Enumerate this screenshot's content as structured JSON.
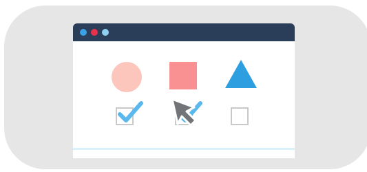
{
  "colors": {
    "page_background": "#ffffff",
    "backdrop": "#e6e6e6",
    "titlebar": "#2a3e5a",
    "window_controls": [
      "#3ca0e6",
      "#e8314b",
      "#8fd0f2"
    ],
    "circle": "#fcc6bd",
    "square": "#f99193",
    "triangle": "#2d9ee0",
    "checkbox_border": "#c9c9c9",
    "checkmark": "#5bb8ec",
    "cursor_fill": "#727478",
    "cursor_outline": "#ffffff",
    "footer_line": "#d9f1fb"
  },
  "window": {
    "controls": [
      "close-dot",
      "minimize-dot",
      "maximize-dot"
    ]
  },
  "options": [
    {
      "shape": "circle",
      "checked": true
    },
    {
      "shape": "square",
      "checked": true
    },
    {
      "shape": "triangle",
      "checked": false
    }
  ],
  "icons": {
    "checkmark": "checkmark-icon",
    "cursor": "mouse-pointer-icon"
  }
}
